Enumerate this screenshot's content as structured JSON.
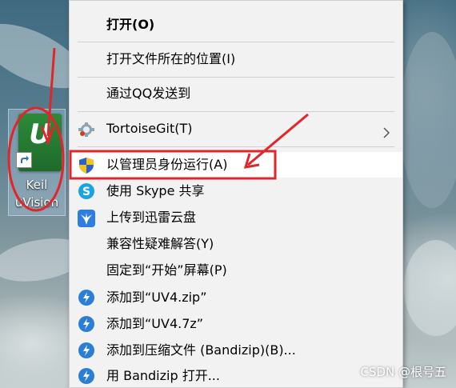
{
  "desktop": {
    "icon_caption_line1": "Keil",
    "icon_caption_line2": "uVision",
    "icon_letter": "U"
  },
  "menu": {
    "items": [
      {
        "label": "打开(O)",
        "icon": "none",
        "bold": true
      },
      {
        "label": "打开文件所在的位置(I)",
        "icon": "none"
      },
      {
        "label": "通过QQ发送到",
        "icon": "none"
      },
      {
        "label": "TortoiseGit(T)",
        "icon": "tortoisegit-icon",
        "submenu": true
      },
      {
        "label": "以管理员身份运行(A)",
        "icon": "uac-shield-icon",
        "highlighted": true
      },
      {
        "label": "使用 Skype 共享",
        "icon": "skype-icon"
      },
      {
        "label": "上传到迅雷云盘",
        "icon": "xunlei-icon"
      },
      {
        "label": "兼容性疑难解答(Y)",
        "icon": "none"
      },
      {
        "label": "固定到“开始”屏幕(P)",
        "icon": "none"
      },
      {
        "label": "添加到“UV4.zip”",
        "icon": "bandizip-icon"
      },
      {
        "label": "添加到“UV4.7z”",
        "icon": "bandizip-icon"
      },
      {
        "label": "添加到压缩文件 (Bandizip)(B)...",
        "icon": "bandizip-icon"
      },
      {
        "label": "用 Bandizip 打开...",
        "icon": "bandizip-icon"
      }
    ]
  },
  "annotation_colors": {
    "red": "#e0262b"
  },
  "watermark": "CSDN @根号五"
}
